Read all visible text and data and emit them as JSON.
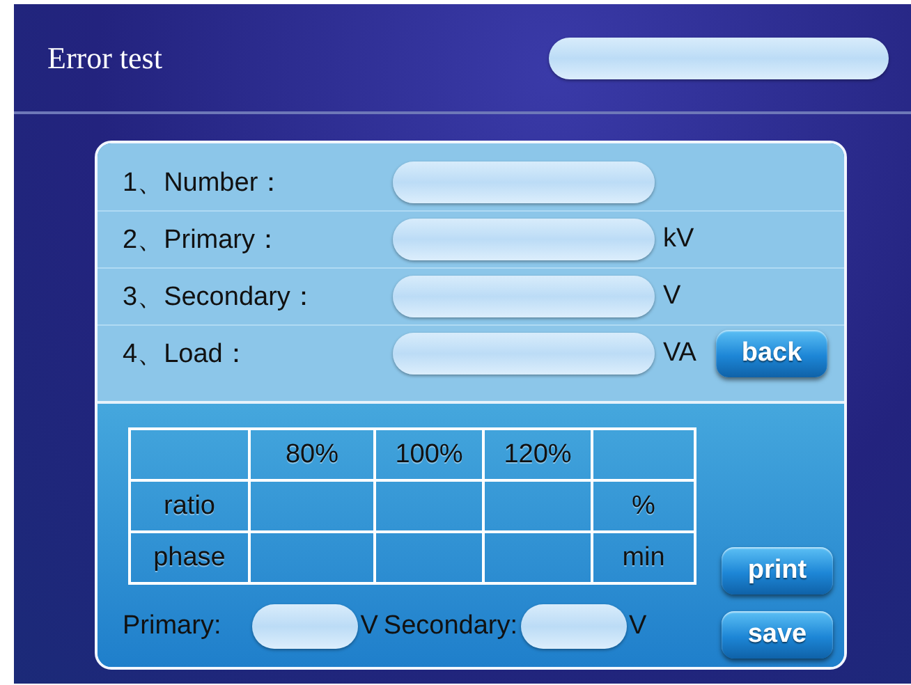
{
  "window": {
    "title": "Error test"
  },
  "form_rows": [
    {
      "label": "1、Number：",
      "unit": null
    },
    {
      "label": "2、Primary：",
      "unit": "kV"
    },
    {
      "label": "3、Secondary：",
      "unit": "V"
    },
    {
      "label": "4、Load：",
      "unit": "VA"
    }
  ],
  "table": {
    "columns": [
      "80%",
      "100%",
      "120%"
    ],
    "rows": [
      {
        "label": "ratio",
        "unit": "%"
      },
      {
        "label": "phase",
        "unit": "min"
      }
    ]
  },
  "voltages": [
    {
      "label": "Primary:",
      "unit": "V"
    },
    {
      "label": "Secondary:",
      "unit": "V"
    }
  ],
  "buttons": {
    "back": "back",
    "print": "print",
    "save": "save"
  }
}
